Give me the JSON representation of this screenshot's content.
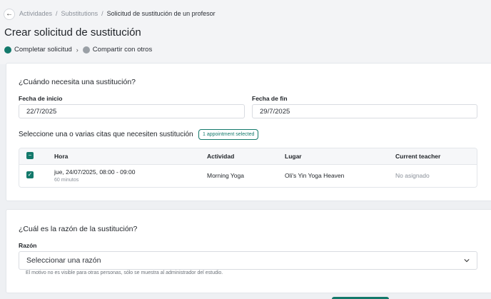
{
  "breadcrumb": {
    "items": [
      "Actividades",
      "Substitutions",
      "Solicitud de sustitución de un profesor"
    ],
    "separator": "/"
  },
  "page_title": "Crear solicitud de sustitución",
  "steps": {
    "step1": "Completar solicitud",
    "separator": "›",
    "step2": "Compartir con otros"
  },
  "when_section": {
    "title": "¿Cuándo necesita una sustitución?",
    "start_label": "Fecha de inicio",
    "start_value": "22/7/2025",
    "end_label": "Fecha de fin",
    "end_value": "29/7/2025",
    "appointments_label": "Seleccione una o varias citas que necesiten sustitución",
    "selected_badge": "1 appointment selected"
  },
  "table": {
    "headers": {
      "time": "Hora",
      "activity": "Actividad",
      "location": "Lugar",
      "teacher": "Current teacher"
    },
    "rows": [
      {
        "time": "jue, 24/07/2025, 08:00 - 09:00",
        "duration": "60 minutos",
        "activity": "Morning Yoga",
        "location": "Oli's Yin Yoga Heaven",
        "teacher": "No asignado"
      }
    ]
  },
  "reason_section": {
    "title": "¿Cuál es la razón de la sustitución?",
    "reason_label": "Razón",
    "reason_placeholder": "Seleccionar una razón",
    "help_text": "El motivo no es visible para otras personas, sólo se muestra al administrador del estudio."
  },
  "colors": {
    "accent": "#13796b",
    "muted_dot": "#9aa0a6",
    "background": "#eef0f3"
  },
  "icons": {
    "back": "arrow-left-icon",
    "checkbox_header": "minus-checkbox-icon",
    "checkbox_row": "check-icon",
    "select_chevron": "chevron-down-icon"
  }
}
